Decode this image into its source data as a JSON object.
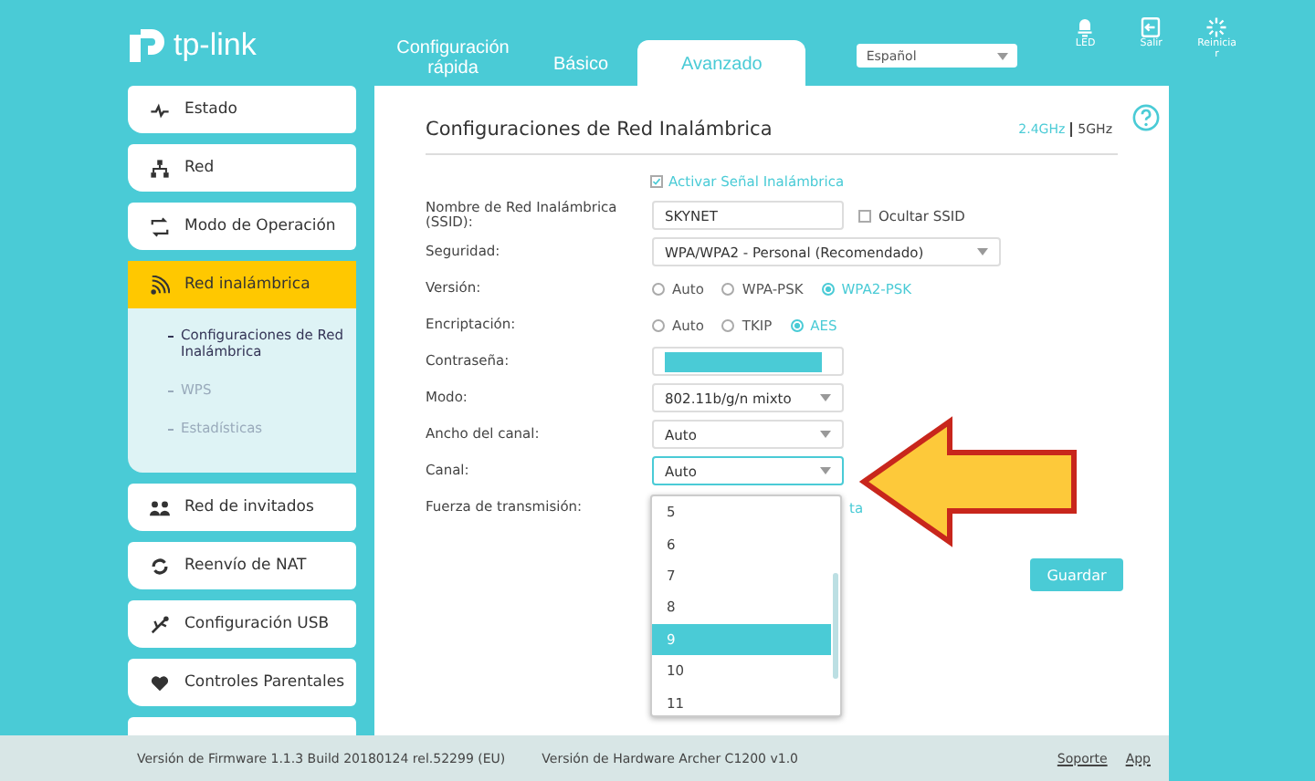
{
  "header": {
    "logo": "tp-link",
    "nav_tabs": [
      {
        "label": "Configuración rápida",
        "selected": false
      },
      {
        "label": "Básico",
        "selected": false
      },
      {
        "label": "Avanzado",
        "selected": true
      }
    ],
    "language": "Español",
    "actions": [
      {
        "kind": "led",
        "label": "LED"
      },
      {
        "kind": "logout",
        "label": "Salir"
      },
      {
        "kind": "reboot",
        "label": "Reiniciar"
      }
    ]
  },
  "sidebar": {
    "items": [
      {
        "kind": "status",
        "label": "Estado",
        "selected": false
      },
      {
        "kind": "network",
        "label": "Red",
        "selected": false
      },
      {
        "kind": "mode",
        "label": "Modo de Operación",
        "selected": false
      },
      {
        "kind": "wireless",
        "label": "Red inalámbrica",
        "selected": true,
        "children": [
          {
            "label": "Configuraciones de Red Inalámbrica",
            "selected": true
          },
          {
            "label": "WPS",
            "selected": false
          },
          {
            "label": "Estadísticas",
            "selected": false
          }
        ]
      },
      {
        "kind": "guests",
        "label": "Red de invitados",
        "selected": false
      },
      {
        "kind": "nat",
        "label": "Reenvío de NAT",
        "selected": false
      },
      {
        "kind": "usb",
        "label": "Configuración USB",
        "selected": false
      },
      {
        "kind": "parental",
        "label": "Controles Parentales",
        "selected": false
      }
    ]
  },
  "panel": {
    "title": "Configuraciones de Red Inalámbrica",
    "bands": [
      {
        "label": "2.4GHz",
        "selected": true
      },
      {
        "label": "5GHz",
        "selected": false
      }
    ],
    "enable_signal": {
      "label": "Activar Señal Inalámbrica",
      "checked": true
    },
    "fields": [
      {
        "kind": "text",
        "label": "Nombre de Red Inalámbrica (SSID):",
        "value": "SKYNET",
        "extra": {
          "label": "Ocultar SSID",
          "checked": false
        }
      },
      {
        "kind": "select",
        "wide": true,
        "label": "Seguridad:",
        "value": "WPA/WPA2 - Personal (Recomendado)"
      },
      {
        "kind": "radio",
        "label": "Versión:",
        "options": [
          {
            "label": "Auto",
            "selected": false
          },
          {
            "label": "WPA-PSK",
            "selected": false
          },
          {
            "label": "WPA2-PSK",
            "selected": true
          }
        ]
      },
      {
        "kind": "radio",
        "label": "Encriptación:",
        "options": [
          {
            "label": "Auto",
            "selected": false
          },
          {
            "label": "TKIP",
            "selected": false
          },
          {
            "label": "AES",
            "selected": true
          }
        ]
      },
      {
        "kind": "password",
        "label": "Contraseña:"
      },
      {
        "kind": "select",
        "label": "Modo:",
        "value": "802.11b/g/n mixto"
      },
      {
        "kind": "select",
        "label": "Ancho del canal:",
        "value": "Auto"
      },
      {
        "kind": "select",
        "label": "Canal:",
        "value": "Auto",
        "focused": true
      },
      {
        "kind": "partial",
        "label": "Fuerza de transmisión:",
        "value": "ta"
      }
    ],
    "channel_dropdown": {
      "options": [
        {
          "label": "5",
          "selected": false
        },
        {
          "label": "6",
          "selected": false
        },
        {
          "label": "7",
          "selected": false
        },
        {
          "label": "8",
          "selected": false
        },
        {
          "label": "9",
          "selected": true
        },
        {
          "label": "10",
          "selected": false
        },
        {
          "label": "11",
          "selected": false
        }
      ]
    },
    "save_button": "Guardar"
  },
  "footer": {
    "firmware": "Versión de Firmware 1.1.3 Build 20180124 rel.52299 (EU)",
    "hardware": "Versión de Hardware Archer C1200 v1.0",
    "links": [
      "Soporte",
      "App"
    ]
  }
}
